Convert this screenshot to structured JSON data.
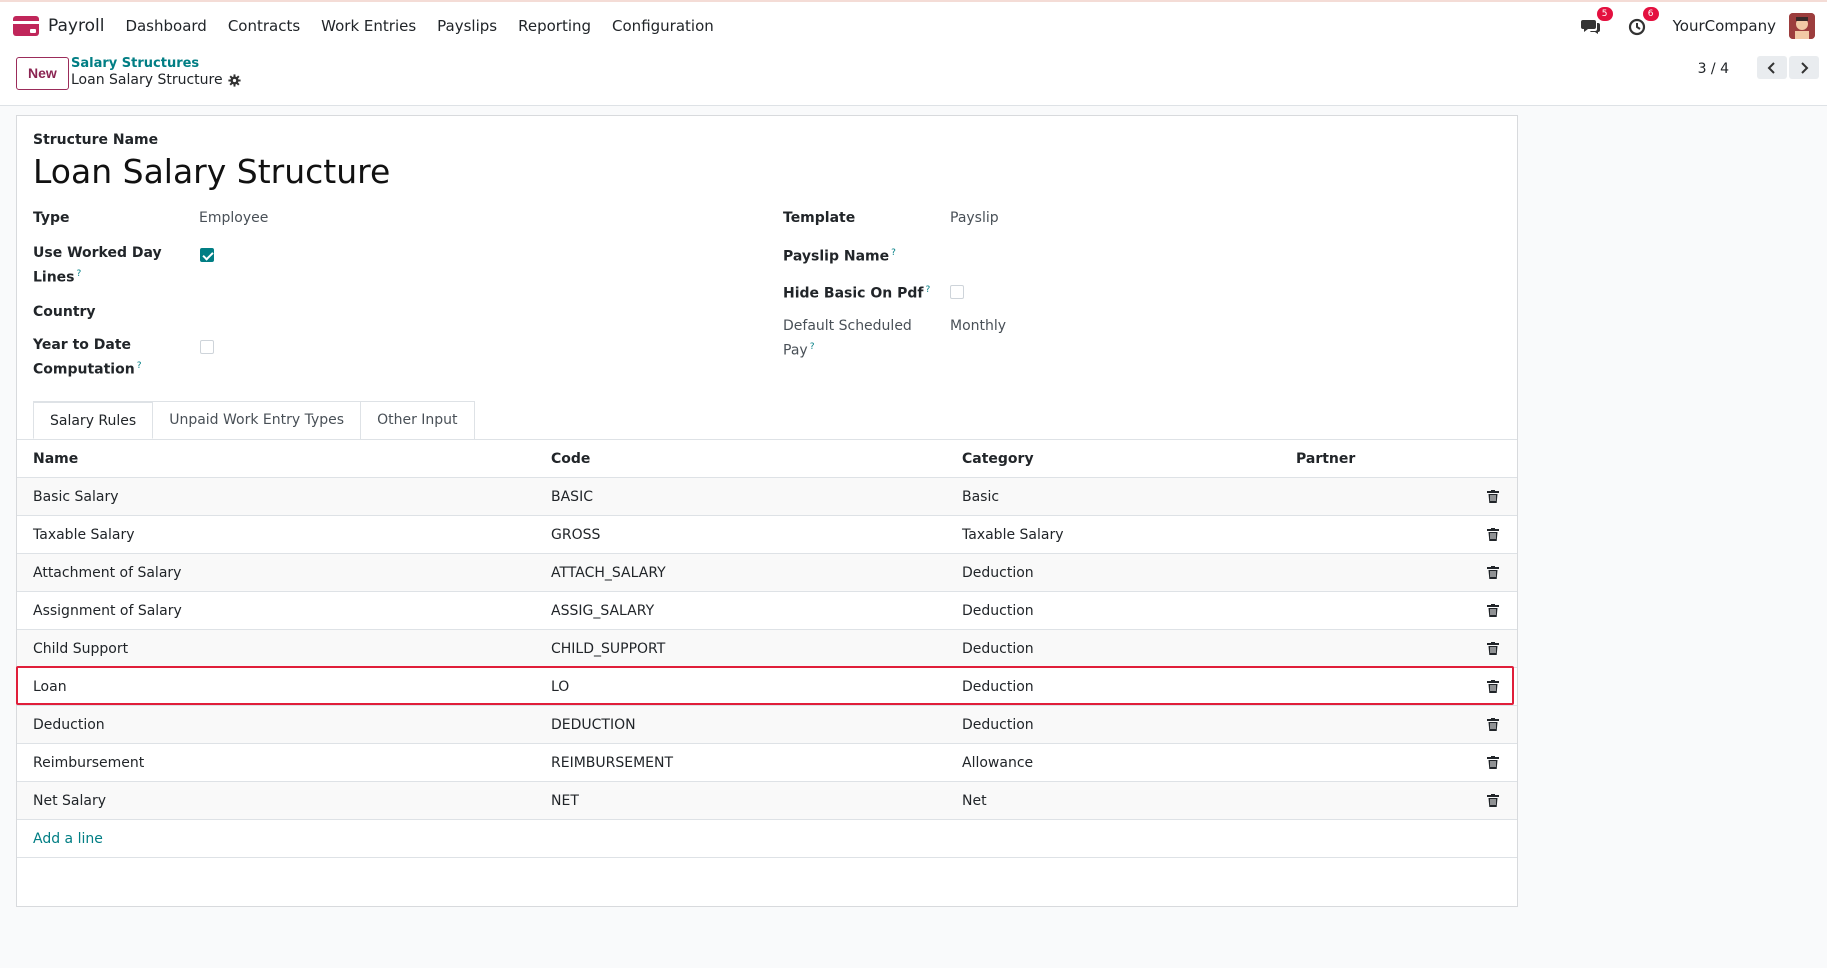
{
  "app": {
    "name": "Payroll",
    "menu": [
      "Dashboard",
      "Contracts",
      "Work Entries",
      "Payslips",
      "Reporting",
      "Configuration"
    ],
    "messages_count": "5",
    "activities_count": "6",
    "company": "YourCompany"
  },
  "control": {
    "new_label": "New",
    "breadcrumb_parent": "Salary Structures",
    "breadcrumb_current": "Loan Salary Structure",
    "pager": "3 / 4"
  },
  "form": {
    "structure_name_label": "Structure Name",
    "structure_name": "Loan Salary Structure",
    "type_label": "Type",
    "type_value": "Employee",
    "use_worked_day_label_1": "Use Worked Day",
    "use_worked_day_label_2": "Lines",
    "use_worked_day_checked": true,
    "country_label": "Country",
    "ytd_label_1": "Year to Date",
    "ytd_label_2": "Computation",
    "ytd_checked": false,
    "template_label": "Template",
    "template_value": "Payslip",
    "payslip_name_label": "Payslip Name",
    "hide_basic_label": "Hide Basic On Pdf",
    "hide_basic_checked": false,
    "default_pay_label_1": "Default Scheduled",
    "default_pay_label_2": "Pay",
    "default_pay_value": "Monthly",
    "help_mark": "?"
  },
  "tabs": [
    "Salary Rules",
    "Unpaid Work Entry Types",
    "Other Input"
  ],
  "rules_table": {
    "headers": {
      "name": "Name",
      "code": "Code",
      "category": "Category",
      "partner": "Partner"
    },
    "rows": [
      {
        "name": "Basic Salary",
        "code": "BASIC",
        "category": "Basic"
      },
      {
        "name": "Taxable Salary",
        "code": "GROSS",
        "category": "Taxable Salary"
      },
      {
        "name": "Attachment of Salary",
        "code": "ATTACH_SALARY",
        "category": "Deduction"
      },
      {
        "name": "Assignment of Salary",
        "code": "ASSIG_SALARY",
        "category": "Deduction"
      },
      {
        "name": "Child Support",
        "code": "CHILD_SUPPORT",
        "category": "Deduction"
      },
      {
        "name": "Loan",
        "code": "LO",
        "category": "Deduction"
      },
      {
        "name": "Deduction",
        "code": "DEDUCTION",
        "category": "Deduction"
      },
      {
        "name": "Reimbursement",
        "code": "REIMBURSEMENT",
        "category": "Allowance"
      },
      {
        "name": "Net Salary",
        "code": "NET",
        "category": "Net"
      }
    ],
    "add_line": "Add a line"
  },
  "colors": {
    "accent": "#017e84",
    "brand": "#c0265a",
    "highlight": "#e01e3a"
  }
}
